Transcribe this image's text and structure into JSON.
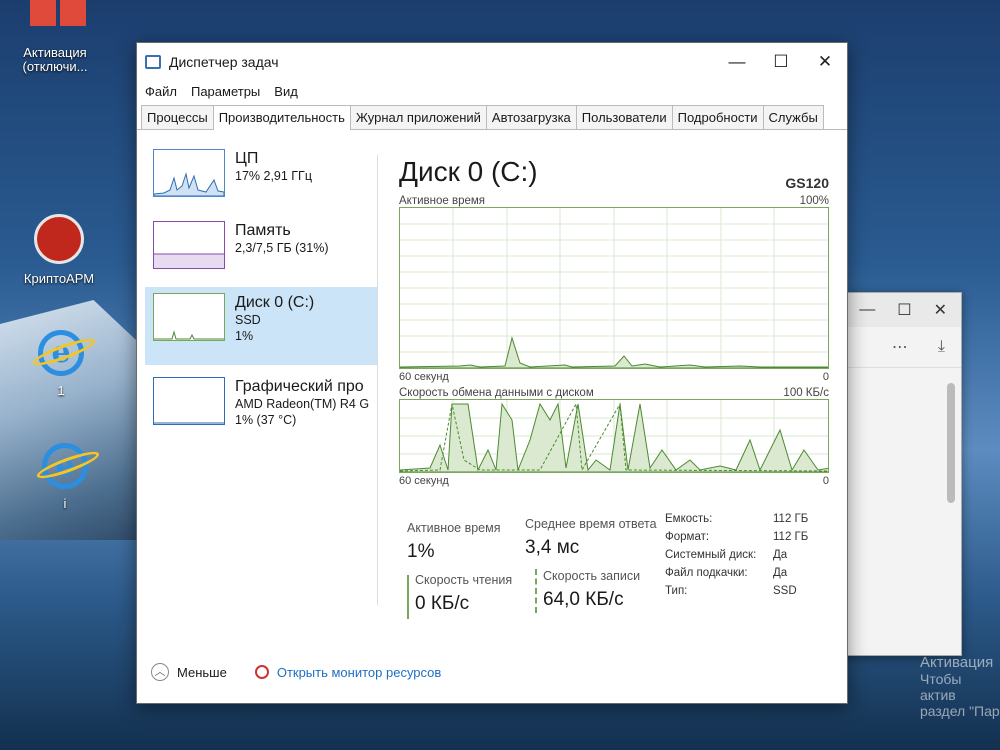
{
  "desktop": {
    "icons": [
      {
        "label": "Активация (отключи..."
      },
      {
        "label": "КриптоАРМ"
      },
      {
        "label": "1"
      },
      {
        "label": "i"
      }
    ],
    "watermark_line1": "Активация",
    "watermark_line2": "Чтобы актив",
    "watermark_line3": "раздел \"Пар"
  },
  "window": {
    "title": "Диспетчер задач",
    "menu": [
      "Файл",
      "Параметры",
      "Вид"
    ],
    "tabs": [
      "Процессы",
      "Производительность",
      "Журнал приложений",
      "Автозагрузка",
      "Пользователи",
      "Подробности",
      "Службы"
    ],
    "active_tab": "Производительность"
  },
  "resources": [
    {
      "name": "ЦП",
      "sub1": "17% 2,91 ГГц",
      "sub2": ""
    },
    {
      "name": "Память",
      "sub1": "2,3/7,5 ГБ (31%)",
      "sub2": ""
    },
    {
      "name": "Диск 0 (C:)",
      "sub1": "SSD",
      "sub2": "1%"
    },
    {
      "name": "Графический про",
      "sub1": "AMD Radeon(TM) R4 G",
      "sub2": "1% (37 °C)"
    }
  ],
  "detail": {
    "title": "Диск 0 (C:)",
    "model": "GS120",
    "graph1": {
      "label": "Активное время",
      "max": "100%",
      "time": "60 секунд",
      "min": "0"
    },
    "graph2": {
      "label": "Скорость обмена данными с диском",
      "max": "100 КБ/с",
      "time": "60 секунд",
      "min": "0"
    },
    "stats": {
      "active_time_label": "Активное время",
      "active_time": "1%",
      "avg_response_label": "Среднее время ответа",
      "avg_response": "3,4 мс",
      "read_label": "Скорость чтения",
      "read": "0 КБ/с",
      "write_label": "Скорость записи",
      "write": "64,0 КБ/с"
    },
    "props": [
      {
        "k": "Емкость:",
        "v": "112 ГБ"
      },
      {
        "k": "Формат:",
        "v": "112 ГБ"
      },
      {
        "k": "Системный диск:",
        "v": "Да"
      },
      {
        "k": "Файл подкачки:",
        "v": "Да"
      },
      {
        "k": "Тип:",
        "v": "SSD"
      }
    ]
  },
  "footer": {
    "less": "Меньше",
    "monitor": "Открыть монитор ресурсов"
  },
  "colors": {
    "accent": "#1e6fc4",
    "disk_graph": "#7aa85a",
    "selected": "#cce4f7"
  }
}
